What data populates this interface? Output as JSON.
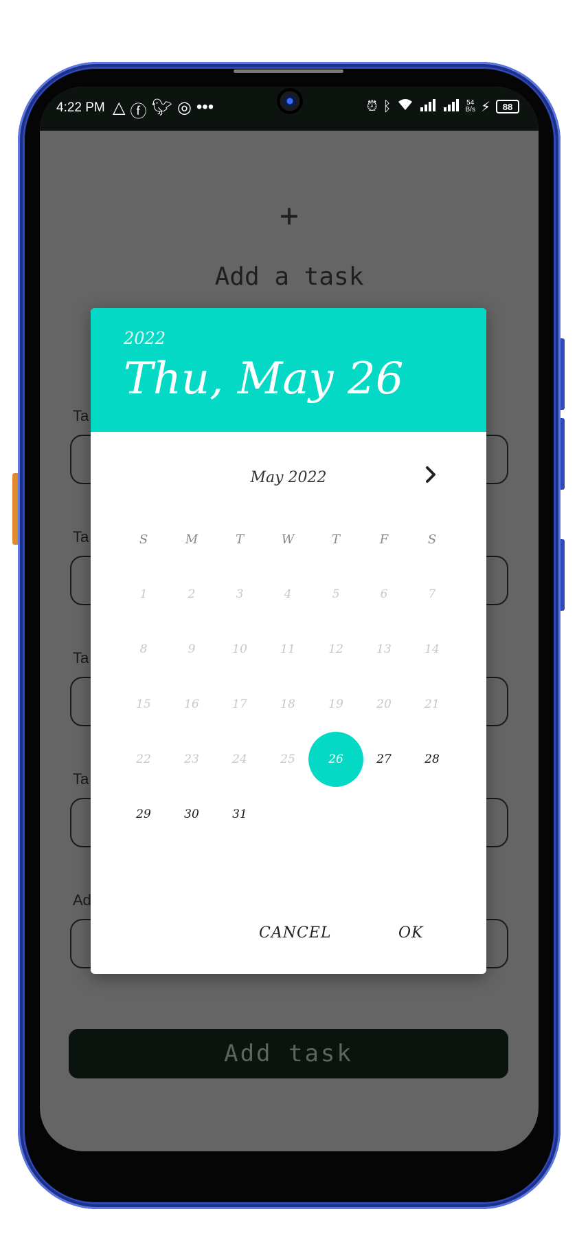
{
  "status_bar": {
    "time": "4:22 PM",
    "left_icons": [
      "delta-icon",
      "facebook-icon",
      "twitter-icon",
      "instagram-icon",
      "more-dots-icon"
    ],
    "right_icons": [
      "alarm-icon",
      "bluetooth-icon",
      "wifi-icon",
      "signal-icon",
      "signal-icon"
    ],
    "net_speed_value": "54",
    "net_speed_unit": "B/s",
    "battery": "88"
  },
  "background": {
    "plus": "+",
    "title": "Add a task",
    "labels": [
      "Ta",
      "Ta",
      "Ta",
      "Ta",
      "Ad"
    ],
    "submit_label": "Add task"
  },
  "date_picker": {
    "header_year": "2022",
    "header_date": "Thu, May 26",
    "month_title": "May 2022",
    "weekdays": [
      "S",
      "M",
      "T",
      "W",
      "T",
      "F",
      "S"
    ],
    "selected_day": "26",
    "cancel_label": "CANCEL",
    "ok_label": "OK",
    "colors": {
      "accent": "#04d9c5",
      "scrim": "#656565"
    }
  }
}
